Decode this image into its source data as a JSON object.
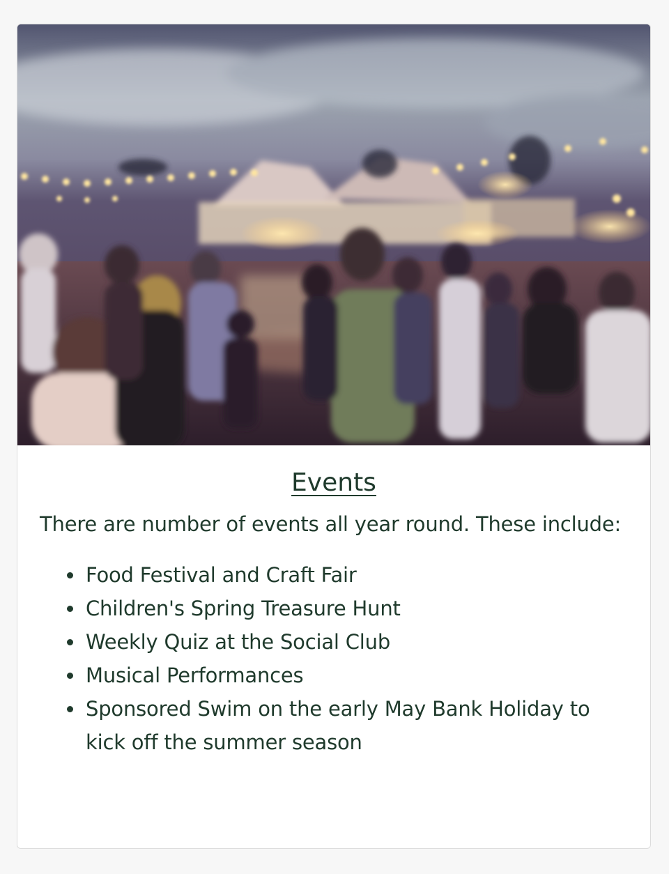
{
  "card": {
    "image": {
      "alt": "Evening market crowd under string lights",
      "icon": "photo-market-scene"
    },
    "title": "Events",
    "intro": "There are number of events all year round. These include:",
    "items": [
      "Food Festival and Craft Fair",
      "Children's Spring Treasure Hunt",
      "Weekly Quiz at the Social Club",
      "Musical Performances",
      "Sponsored Swim on the early May Bank Holiday to kick off the summer season"
    ]
  },
  "colors": {
    "text": "#1f3a2c",
    "background": "#f7f7f7",
    "card": "#ffffff"
  }
}
